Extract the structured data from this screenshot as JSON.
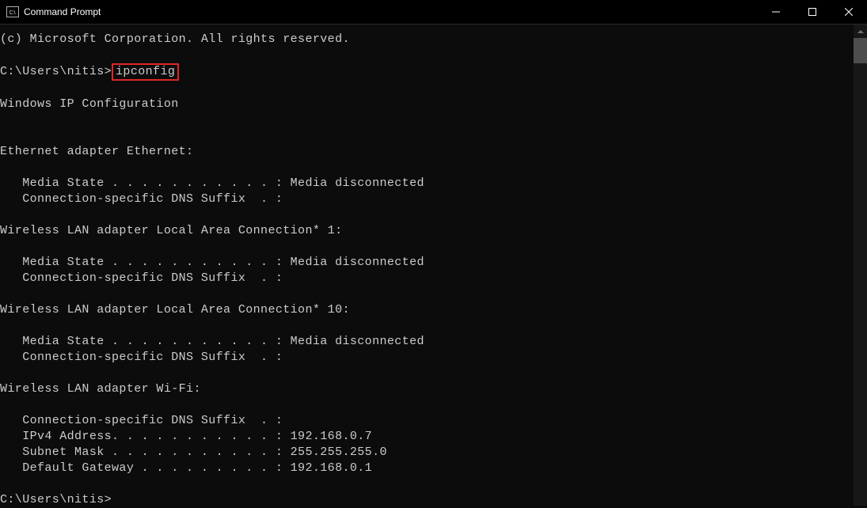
{
  "window": {
    "title": "Command Prompt",
    "icon_text": "C:\\."
  },
  "console": {
    "copyright": "(c) Microsoft Corporation. All rights reserved.",
    "prompt1_prefix": "C:\\Users\\nitis>",
    "prompt1_cmd": "ipconfig",
    "header": "Windows IP Configuration",
    "adapters": [
      {
        "title": "Ethernet adapter Ethernet:",
        "lines": [
          "   Media State . . . . . . . . . . . : Media disconnected",
          "   Connection-specific DNS Suffix  . :"
        ]
      },
      {
        "title": "Wireless LAN adapter Local Area Connection* 1:",
        "lines": [
          "   Media State . . . . . . . . . . . : Media disconnected",
          "   Connection-specific DNS Suffix  . :"
        ]
      },
      {
        "title": "Wireless LAN adapter Local Area Connection* 10:",
        "lines": [
          "   Media State . . . . . . . . . . . : Media disconnected",
          "   Connection-specific DNS Suffix  . :"
        ]
      },
      {
        "title": "Wireless LAN adapter Wi-Fi:",
        "lines": [
          "   Connection-specific DNS Suffix  . :",
          "   IPv4 Address. . . . . . . . . . . : 192.168.0.7",
          "   Subnet Mask . . . . . . . . . . . : 255.255.255.0",
          "   Default Gateway . . . . . . . . . : 192.168.0.1"
        ]
      }
    ],
    "prompt2": "C:\\Users\\nitis>"
  }
}
